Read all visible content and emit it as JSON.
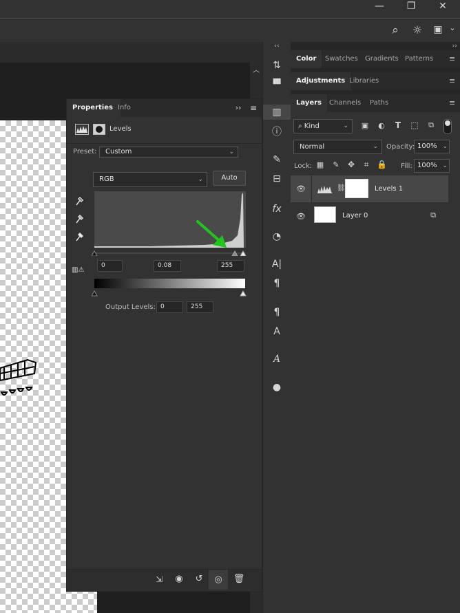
{
  "window": {
    "minimize_glyph": "—",
    "restore_glyph": "❐",
    "close_glyph": "✕"
  },
  "options_bar": {
    "search_glyph": "⌕",
    "bulb_glyph": "☼",
    "layout_glyph": "▣",
    "chevron_glyph": "⌄"
  },
  "collapse_glyph": "‹‹",
  "collapse_right_glyph": "››",
  "doc_scroll_up_glyph": "︿",
  "properties": {
    "tabs": [
      {
        "label": "Properties",
        "active": true
      },
      {
        "label": "Info",
        "active": false
      }
    ],
    "collapse_glyph": "››",
    "menu_glyph": "≡",
    "adjustment_title": "Levels",
    "preset_label": "Preset:",
    "preset_value": "Custom",
    "channel_value": "RGB",
    "auto_label": "Auto",
    "input_black": "0",
    "input_gamma": "0.08",
    "input_white": "255",
    "output_label": "Output Levels:",
    "output_black": "0",
    "output_white": "255",
    "footer_icons": [
      "clip-to-layer-icon",
      "view-previous-icon",
      "reset-icon",
      "visibility-icon",
      "delete-icon"
    ]
  },
  "panels": {
    "row1_tabs": [
      "Color",
      "Swatches",
      "Gradients",
      "Patterns"
    ],
    "row2_tabs": [
      "Adjustments",
      "Libraries"
    ],
    "layers_tabs": [
      "Layers",
      "Channels",
      "Paths"
    ],
    "menu_glyph": "≡",
    "filter_kind": "Kind",
    "blend_mode": "Normal",
    "opacity_label": "Opacity:",
    "opacity_value": "100%",
    "lock_label": "Lock:",
    "fill_label": "Fill:",
    "fill_value": "100%",
    "layers": [
      {
        "name": "Levels 1",
        "type": "adjustment",
        "selected": true
      },
      {
        "name": "Layer 0",
        "type": "pixel",
        "selected": false
      }
    ]
  },
  "colors": {
    "accent_arrow": "#22c41e"
  }
}
